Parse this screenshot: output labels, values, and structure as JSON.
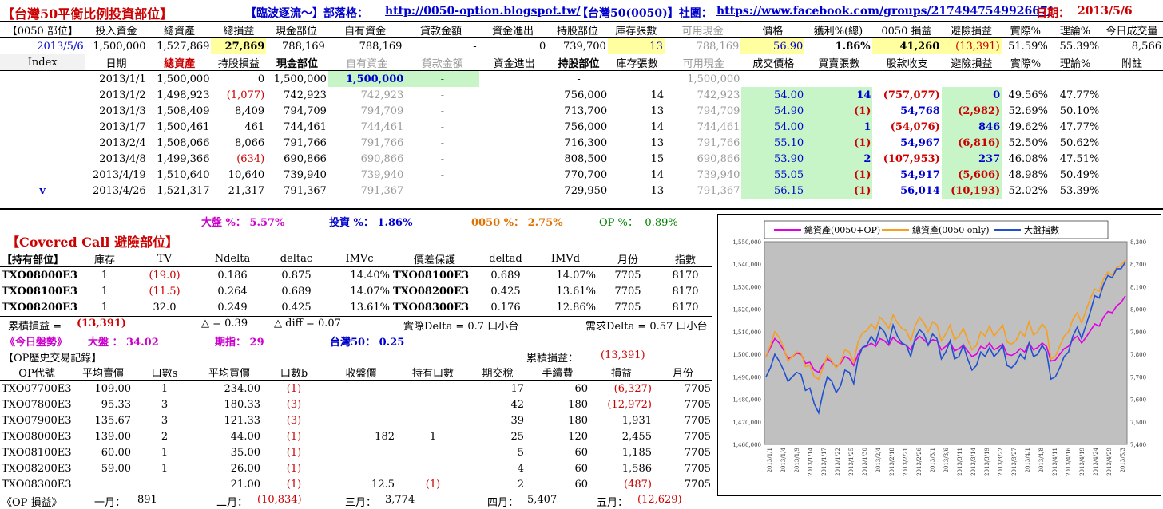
{
  "topbar": {
    "title": "【台灣50平衡比例投資部位】",
    "blog_label": "【臨波逐流～】部落格：",
    "blog_url": "http://0050-option.blogspot.tw/",
    "club_label": "【台灣50(0050)】社團：",
    "club_url": "https://www.facebook.com/groups/217494754992667/",
    "date_label": "日期：",
    "date": "2013/5/6"
  },
  "summary": {
    "headers": [
      "【0050 部位】",
      "投入資金",
      "總資產",
      "總損益",
      "現金部位",
      "自有資金",
      "貸款金額",
      "資金進出",
      "持股部位",
      "庫存張數",
      "可用現金",
      "價格",
      "獲利%(總)",
      "0050 損益",
      "避險損益",
      "實際%",
      "理論%",
      "今日成交量"
    ],
    "values": [
      "2013/5/6",
      "1,500,000",
      "1,527,869",
      "27,869",
      "788,169",
      "788,169",
      "-",
      "0",
      "739,700",
      "13",
      "788,169",
      "56.90",
      "1.86%",
      "41,260",
      "(13,391)",
      "51.59%",
      "55.39%",
      "8,566"
    ]
  },
  "history": {
    "headers": [
      "Index",
      "日期",
      "總資產",
      "持股損益",
      "現金部位",
      "自有資金",
      "貸款金額",
      "資金進出",
      "持股部位",
      "庫存張數",
      "可用現金",
      "成交價格",
      "買賣張數",
      "股款收支",
      "避險損益",
      "實際%",
      "理論%",
      "附註"
    ],
    "rows": [
      [
        "",
        "2013/1/1",
        "1,500,000",
        "0",
        "1,500,000",
        "1,500,000",
        "-",
        "",
        "-",
        "",
        "1,500,000",
        "",
        "",
        "",
        "",
        "",
        "",
        ""
      ],
      [
        "",
        "2013/1/2",
        "1,498,923",
        "(1,077)",
        "742,923",
        "742,923",
        "-",
        "",
        "756,000",
        "14",
        "742,923",
        "54.00",
        "14",
        "(757,077)",
        "0",
        "49.56%",
        "47.77%",
        ""
      ],
      [
        "",
        "2013/1/3",
        "1,508,409",
        "8,409",
        "794,709",
        "794,709",
        "-",
        "",
        "713,700",
        "13",
        "794,709",
        "54.90",
        "(1)",
        "54,768",
        "(2,982)",
        "52.69%",
        "50.10%",
        ""
      ],
      [
        "",
        "2013/1/7",
        "1,500,461",
        "461",
        "744,461",
        "744,461",
        "-",
        "",
        "756,000",
        "14",
        "744,461",
        "54.00",
        "1",
        "(54,076)",
        "846",
        "49.62%",
        "47.77%",
        ""
      ],
      [
        "",
        "2013/2/4",
        "1,508,066",
        "8,066",
        "791,766",
        "791,766",
        "-",
        "",
        "716,300",
        "13",
        "791,766",
        "55.10",
        "(1)",
        "54,967",
        "(6,816)",
        "52.50%",
        "50.62%",
        ""
      ],
      [
        "",
        "2013/4/8",
        "1,499,366",
        "(634)",
        "690,866",
        "690,866",
        "-",
        "",
        "808,500",
        "15",
        "690,866",
        "53.90",
        "2",
        "(107,953)",
        "237",
        "46.08%",
        "47.51%",
        ""
      ],
      [
        "",
        "2013/4/19",
        "1,510,640",
        "10,640",
        "739,940",
        "739,940",
        "-",
        "",
        "770,700",
        "14",
        "739,940",
        "55.05",
        "(1)",
        "54,917",
        "(5,606)",
        "48.98%",
        "50.49%",
        ""
      ],
      [
        "v",
        "2013/4/26",
        "1,521,317",
        "21,317",
        "791,367",
        "791,367",
        "-",
        "",
        "729,950",
        "13",
        "791,367",
        "56.15",
        "(1)",
        "56,014",
        "(10,193)",
        "52.02%",
        "53.39%",
        ""
      ]
    ]
  },
  "returns": {
    "market": "大盤 %： 5.57%",
    "invest": "投資 %： 1.86%",
    "etf": "0050 %： 2.75%",
    "op": "OP %： -0.89%"
  },
  "cc": {
    "title": "【Covered Call 避險部位】",
    "headers": [
      "【持有部位】",
      "庫存",
      "TV",
      "Ndelta",
      "deltac",
      "IMVc",
      "價差保護",
      "deltad",
      "IMVd",
      "月份",
      "指數"
    ],
    "rows": [
      [
        "TXO08000E3",
        "1",
        "(19.0)",
        "0.186",
        "0.875",
        "14.40%",
        "TXO08100E3",
        "0.689",
        "14.07%",
        "7705",
        "8170"
      ],
      [
        "TXO08100E3",
        "1",
        "(11.5)",
        "0.264",
        "0.689",
        "14.07%",
        "TXO08200E3",
        "0.425",
        "13.61%",
        "7705",
        "8170"
      ],
      [
        "TXO08200E3",
        "1",
        "32.0",
        "0.249",
        "0.425",
        "13.61%",
        "TXO08300E3",
        "0.176",
        "12.86%",
        "7705",
        "8170"
      ]
    ],
    "cum_label": "累積損益 =",
    "cum_value": "(13,391)",
    "delta": "△ = 0.39",
    "delta_diff": "△ diff = 0.07",
    "actual_delta": "實際Delta = 0.7 口小台",
    "need_delta": "需求Delta = 0.57 口小台"
  },
  "today": {
    "label": "《今日盤勢》",
    "market": "大盤 ： 34.02",
    "futures": "期指： 29",
    "tw50": "台灣50： 0.25"
  },
  "op": {
    "title": "【OP歷史交易記錄】",
    "cum_label": "累積損益：",
    "cum_value": "(13,391)",
    "headers": [
      "OP代號",
      "平均賣價",
      "口數s",
      "平均買價",
      "口數b",
      "收盤價",
      "持有口數",
      "期交稅",
      "手續費",
      "損益",
      "月份"
    ],
    "rows": [
      [
        "TXO07700E3",
        "109.00",
        "1",
        "234.00",
        "(1)",
        "",
        "",
        "17",
        "60",
        "(6,327)",
        "7705"
      ],
      [
        "TXO07800E3",
        "95.33",
        "3",
        "180.33",
        "(3)",
        "",
        "",
        "42",
        "180",
        "(12,972)",
        "7705"
      ],
      [
        "TXO07900E3",
        "135.67",
        "3",
        "121.33",
        "(3)",
        "",
        "",
        "39",
        "180",
        "1,931",
        "7705"
      ],
      [
        "TXO08000E3",
        "139.00",
        "2",
        "44.00",
        "(1)",
        "182",
        "1",
        "25",
        "120",
        "2,455",
        "7705"
      ],
      [
        "TXO08100E3",
        "60.00",
        "1",
        "35.00",
        "(1)",
        "",
        "",
        "5",
        "60",
        "1,185",
        "7705"
      ],
      [
        "TXO08200E3",
        "59.00",
        "1",
        "26.00",
        "(1)",
        "",
        "",
        "4",
        "60",
        "1,586",
        "7705"
      ],
      [
        "TXO08300E3",
        "",
        "",
        "21.00",
        "(1)",
        "12.5",
        "(1)",
        "2",
        "60",
        "(487)",
        "7705"
      ]
    ],
    "monthly_label": "《OP 損益》",
    "monthly": [
      {
        "label": "一月：",
        "value": "891"
      },
      {
        "label": "二月：",
        "value": "(10,834)"
      },
      {
        "label": "三月：",
        "value": "3,774"
      },
      {
        "label": "四月：",
        "value": "5,407"
      },
      {
        "label": "五月：",
        "value": "(12,629)"
      }
    ]
  },
  "chart_data": {
    "type": "line",
    "legend": [
      "總資產(0050+OP)",
      "總資產(0050 only)",
      "大盤指數"
    ],
    "colors": [
      "#e000e0",
      "#f5a020",
      "#2050d0"
    ],
    "ylim_left": [
      1460000,
      1550000
    ],
    "ylim_right": [
      7400,
      8300
    ],
    "yticks_left": [
      "1,550,000",
      "1,540,000",
      "1,530,000",
      "1,520,000",
      "1,510,000",
      "1,500,000",
      "1,490,000",
      "1,480,000",
      "1,470,000",
      "1,460,000"
    ],
    "yticks_right": [
      "8,300",
      "8,200",
      "8,100",
      "8,000",
      "7,900",
      "7,800",
      "7,700",
      "7,600",
      "7,500",
      "7,400"
    ],
    "xticks": [
      "2013/1/1",
      "2013/1/4",
      "2013/1/9",
      "2013/1/14",
      "2013/1/17",
      "2013/1/22",
      "2013/1/25",
      "2013/1/30",
      "2013/2/4",
      "2013/2/18",
      "2013/2/21",
      "2013/2/26",
      "2013/3/1",
      "2013/3/6",
      "2013/3/11",
      "2013/3/14",
      "2013/3/19",
      "2013/3/22",
      "2013/3/27",
      "2013/4/1",
      "2013/4/8",
      "2013/4/11",
      "2013/4/16",
      "2013/4/19",
      "2013/4/24",
      "2013/4/29",
      "2013/5/3"
    ],
    "series": [
      {
        "name": "總資產(0050+OP)",
        "axis": "left",
        "values": [
          1499000,
          1503000,
          1507000,
          1505000,
          1502000,
          1498000,
          1499000,
          1500500,
          1500000,
          1496000,
          1496500,
          1493000,
          1492000,
          1495500,
          1498000,
          1496500,
          1494500,
          1496000,
          1499000,
          1498000,
          1495000,
          1500000,
          1503000,
          1503500,
          1505000,
          1503500,
          1507000,
          1506000,
          1504000,
          1507500,
          1505500,
          1504500,
          1504000,
          1502000,
          1506000,
          1508000,
          1506500,
          1504500,
          1506500,
          1506000,
          1502000,
          1503500,
          1505500,
          1501500,
          1502500,
          1504000,
          1501500,
          1499000,
          1500000,
          1503500,
          1502500,
          1505000,
          1502000,
          1503000,
          1504500,
          1500000,
          1499500,
          1500500,
          1502500,
          1501000,
          1505000,
          1502000,
          1503000,
          1505000,
          1503500,
          1497000,
          1497500,
          1500000,
          1502500,
          1503500,
          1506500,
          1508000,
          1505000,
          1507500,
          1510500,
          1513500,
          1512500,
          1516500,
          1519000,
          1518500,
          1521500,
          1523000,
          1526000
        ]
      },
      {
        "name": "總資產(0050 only)",
        "axis": "left",
        "values": [
          1499000,
          1504000,
          1510000,
          1507500,
          1503000,
          1497000,
          1499000,
          1501000,
          1500500,
          1494500,
          1495000,
          1490000,
          1489000,
          1494000,
          1499500,
          1497000,
          1494000,
          1496500,
          1502000,
          1501000,
          1496500,
          1505500,
          1509500,
          1510500,
          1513500,
          1511000,
          1516500,
          1514500,
          1511500,
          1517500,
          1514000,
          1511500,
          1510500,
          1506000,
          1512500,
          1516500,
          1514000,
          1510000,
          1514500,
          1513000,
          1506000,
          1509000,
          1513000,
          1506500,
          1508000,
          1511500,
          1506500,
          1502000,
          1504000,
          1510000,
          1508000,
          1512500,
          1508000,
          1510500,
          1513000,
          1505500,
          1504500,
          1506000,
          1510000,
          1508000,
          1514500,
          1508500,
          1510000,
          1513500,
          1511000,
          1498000,
          1499000,
          1503500,
          1508000,
          1510000,
          1515500,
          1518500,
          1514000,
          1519500,
          1525000,
          1529000,
          1528000,
          1533500,
          1536500,
          1535000,
          1538500,
          1539500,
          1542000
        ]
      },
      {
        "name": "大盤指數",
        "axis": "right",
        "values": [
          7700,
          7740,
          7800,
          7770,
          7730,
          7680,
          7700,
          7720,
          7710,
          7640,
          7650,
          7580,
          7540,
          7630,
          7700,
          7680,
          7630,
          7660,
          7730,
          7720,
          7670,
          7780,
          7830,
          7840,
          7880,
          7850,
          7920,
          7900,
          7850,
          7930,
          7880,
          7850,
          7840,
          7790,
          7870,
          7910,
          7890,
          7840,
          7890,
          7870,
          7780,
          7810,
          7860,
          7780,
          7790,
          7840,
          7780,
          7730,
          7750,
          7810,
          7790,
          7830,
          7790,
          7810,
          7840,
          7750,
          7740,
          7760,
          7800,
          7780,
          7850,
          7790,
          7800,
          7840,
          7810,
          7690,
          7700,
          7740,
          7790,
          7810,
          7880,
          7920,
          7870,
          7930,
          7990,
          8060,
          8050,
          8110,
          8150,
          8140,
          8180,
          8180,
          8210
        ]
      }
    ]
  }
}
